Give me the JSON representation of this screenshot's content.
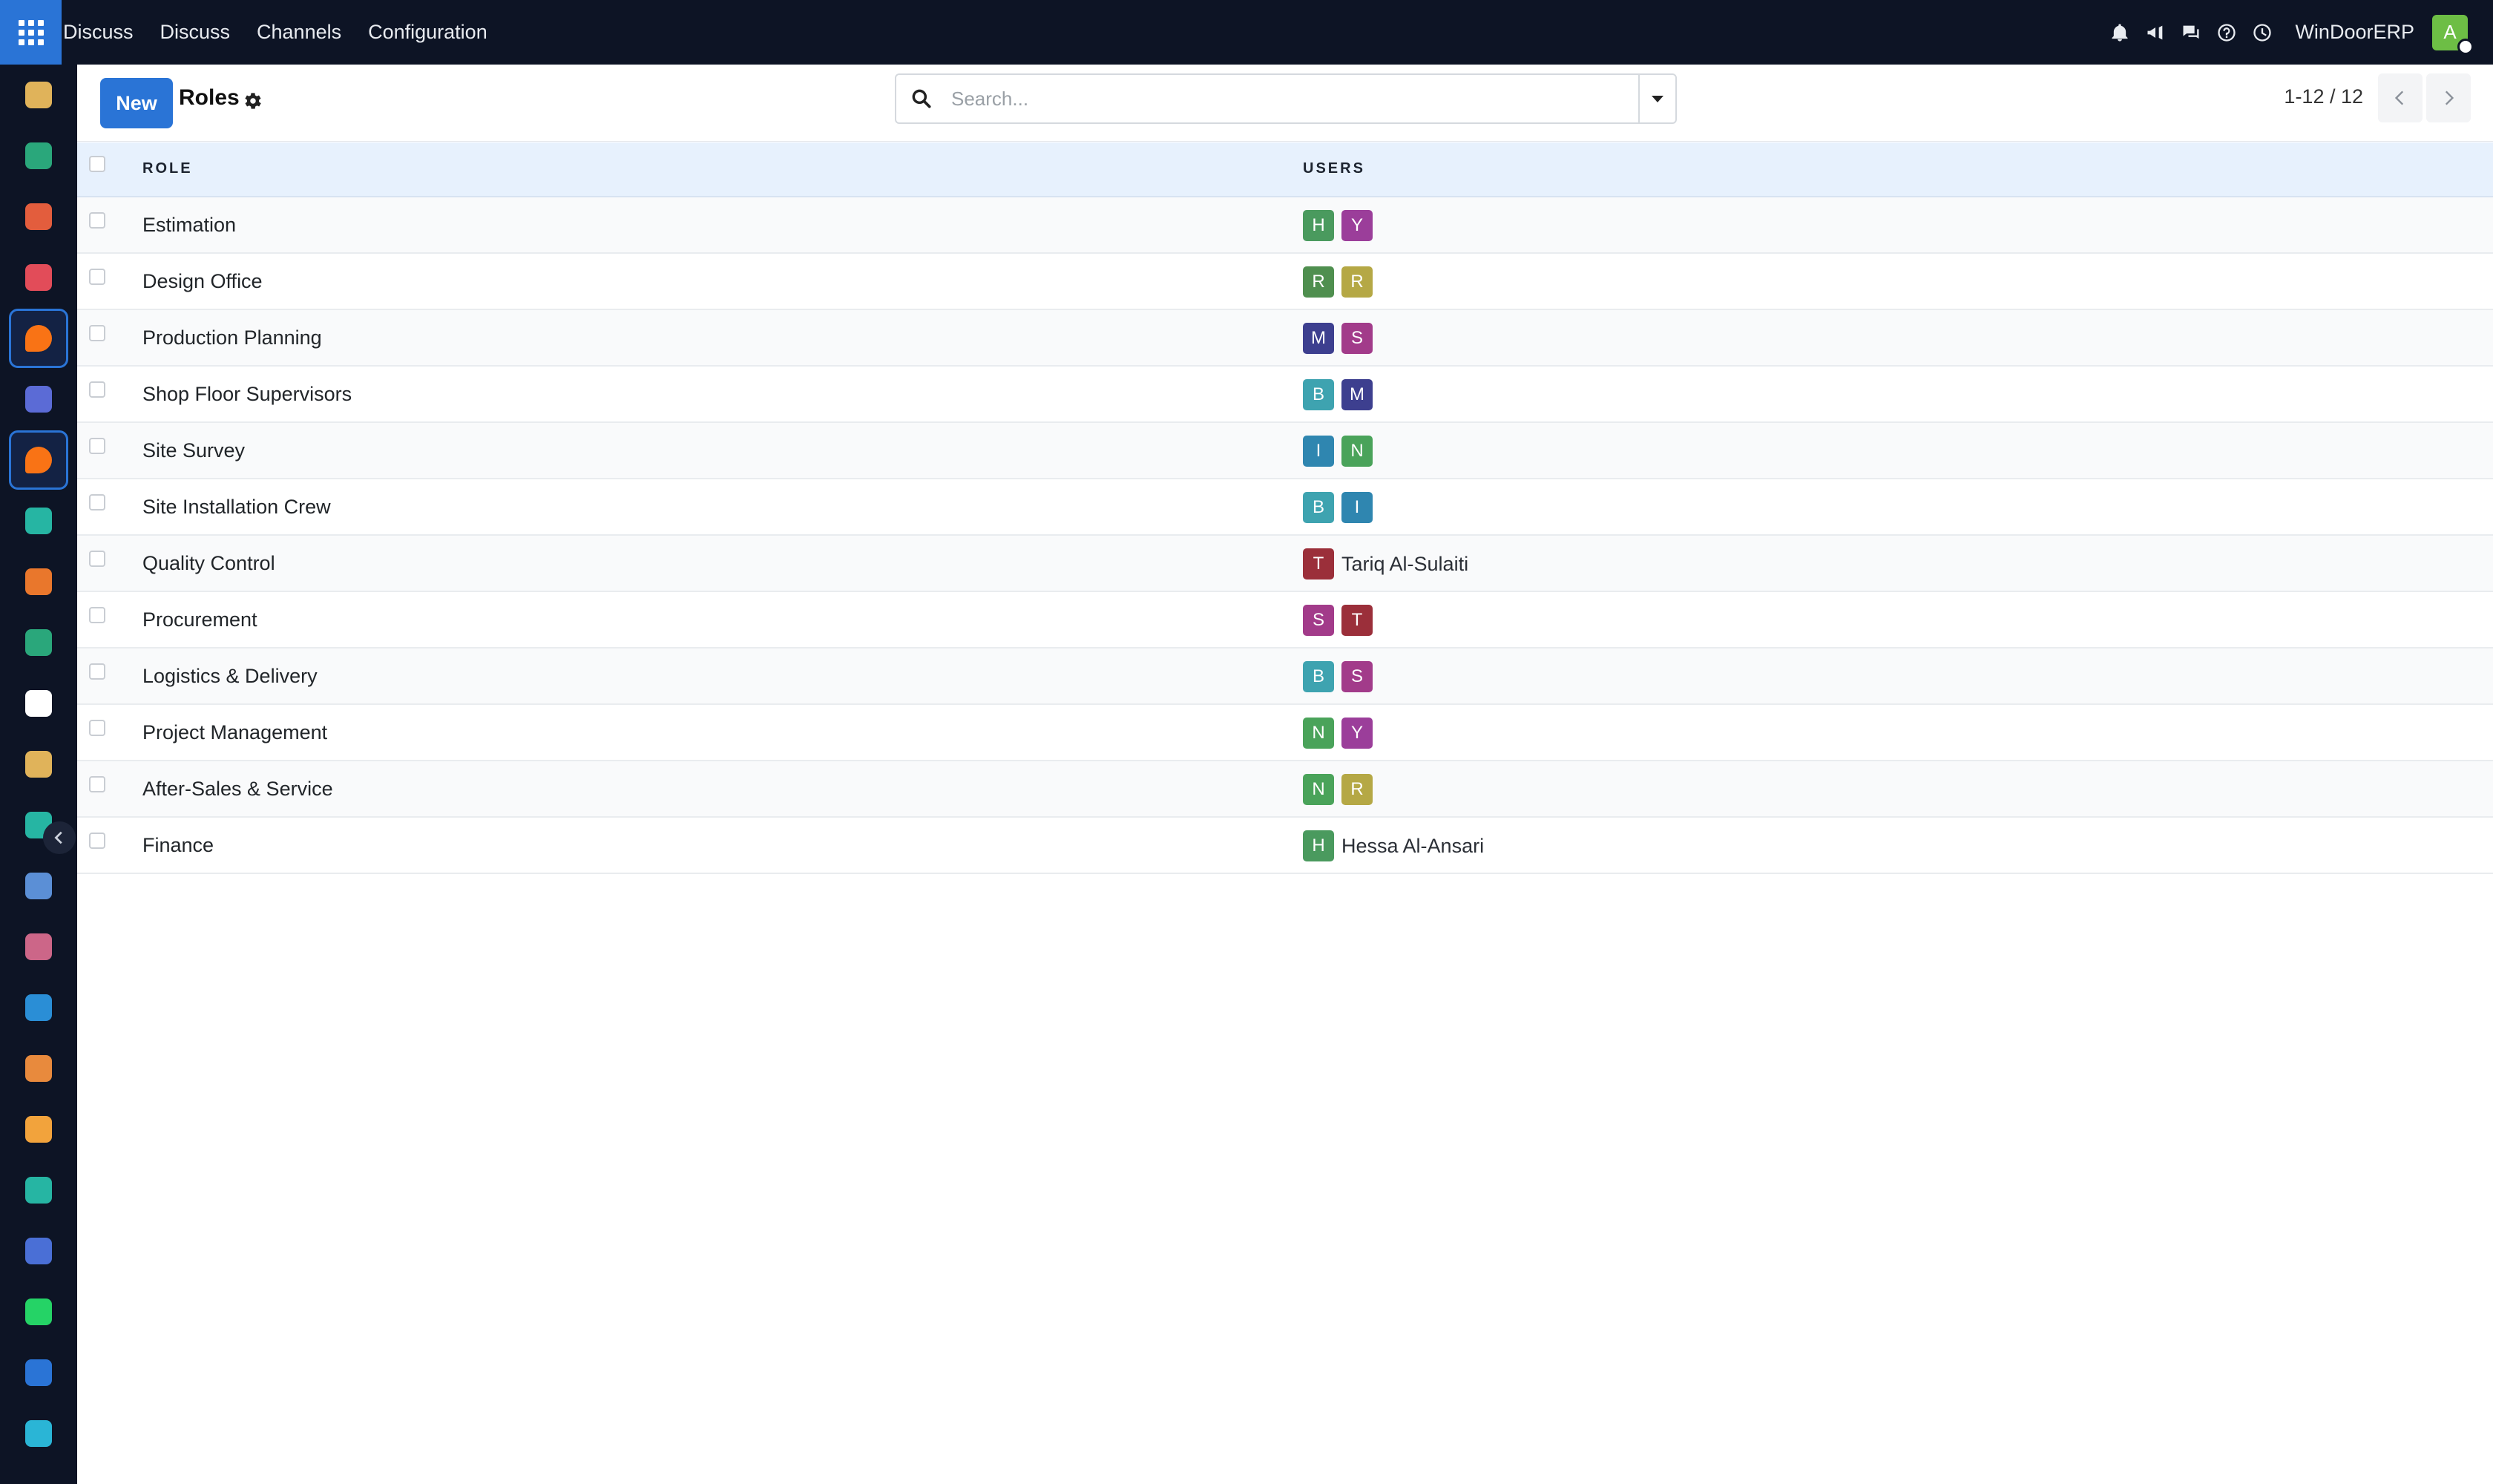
{
  "navbar": {
    "menu": [
      "Discuss",
      "Discuss",
      "Channels",
      "Configuration"
    ],
    "company": "WinDoorERP",
    "user_initial": "A",
    "user_color": "#6dbe45"
  },
  "sidebar": {
    "apps": [
      {
        "name": "app-1",
        "color": "#e0b35a"
      },
      {
        "name": "app-2",
        "color": "#2aa77b"
      },
      {
        "name": "app-3",
        "color": "#e35d3d"
      },
      {
        "name": "app-4",
        "color": "#e24c59"
      },
      {
        "name": "discuss",
        "color": "#f97315",
        "active": true
      },
      {
        "name": "mail",
        "color": "#5b6bd6"
      },
      {
        "name": "discuss-2",
        "color": "#f97315",
        "active": true
      },
      {
        "name": "app-8",
        "color": "#26b5a3"
      },
      {
        "name": "app-9",
        "color": "#e9772c"
      },
      {
        "name": "app-10",
        "color": "#2aa77b"
      },
      {
        "name": "app-11",
        "color": "#ffffff"
      },
      {
        "name": "app-12",
        "color": "#e0b35a"
      },
      {
        "name": "app-13",
        "color": "#26b5a3"
      },
      {
        "name": "app-14",
        "color": "#5b8fd6"
      },
      {
        "name": "app-15",
        "color": "#cc6688"
      },
      {
        "name": "app-16",
        "color": "#2a8ed6"
      },
      {
        "name": "app-17",
        "color": "#e88a3d"
      },
      {
        "name": "calendar",
        "color": "#f2a33c"
      },
      {
        "name": "app-19",
        "color": "#26b5a3"
      },
      {
        "name": "app-20",
        "color": "#4a6fd6"
      },
      {
        "name": "whatsapp",
        "color": "#25d366"
      },
      {
        "name": "app-22",
        "color": "#2a74d6"
      },
      {
        "name": "app-23",
        "color": "#2ab5d6"
      }
    ]
  },
  "control": {
    "new_label": "New",
    "breadcrumb": "Roles",
    "search_placeholder": "Search...",
    "pager": "1-12 / 12"
  },
  "table": {
    "headers": {
      "role": "ROLE",
      "users": "USERS"
    },
    "rows": [
      {
        "role": "Estimation",
        "users": [
          {
            "i": "H",
            "c": "#4a9a5e"
          },
          {
            "i": "Y",
            "c": "#9b3e9a"
          }
        ]
      },
      {
        "role": "Design Office",
        "users": [
          {
            "i": "R",
            "c": "#4f8f4f"
          },
          {
            "i": "R",
            "c": "#b5a845"
          }
        ]
      },
      {
        "role": "Production Planning",
        "users": [
          {
            "i": "M",
            "c": "#3d3f8f"
          },
          {
            "i": "S",
            "c": "#a23b8a"
          }
        ]
      },
      {
        "role": "Shop Floor Supervisors",
        "users": [
          {
            "i": "B",
            "c": "#3ea3b0"
          },
          {
            "i": "M",
            "c": "#3d3f8f"
          }
        ]
      },
      {
        "role": "Site Survey",
        "users": [
          {
            "i": "I",
            "c": "#2f86b0"
          },
          {
            "i": "N",
            "c": "#4aa35a"
          }
        ]
      },
      {
        "role": "Site Installation Crew",
        "users": [
          {
            "i": "B",
            "c": "#3ea3b0"
          },
          {
            "i": "I",
            "c": "#2f86b0"
          }
        ]
      },
      {
        "role": "Quality Control",
        "users": [
          {
            "i": "T",
            "c": "#9b2f3a"
          }
        ],
        "single_name": "Tariq Al-Sulaiti"
      },
      {
        "role": "Procurement",
        "users": [
          {
            "i": "S",
            "c": "#a23b8a"
          },
          {
            "i": "T",
            "c": "#9b2f3a"
          }
        ]
      },
      {
        "role": "Logistics & Delivery",
        "users": [
          {
            "i": "B",
            "c": "#3ea3b0"
          },
          {
            "i": "S",
            "c": "#a23b8a"
          }
        ]
      },
      {
        "role": "Project Management",
        "users": [
          {
            "i": "N",
            "c": "#4aa35a"
          },
          {
            "i": "Y",
            "c": "#9b3e9a"
          }
        ]
      },
      {
        "role": "After-Sales & Service",
        "users": [
          {
            "i": "N",
            "c": "#4aa35a"
          },
          {
            "i": "R",
            "c": "#b5a845"
          }
        ]
      },
      {
        "role": "Finance",
        "users": [
          {
            "i": "H",
            "c": "#4a9a5e"
          }
        ],
        "single_name": "Hessa Al-Ansari"
      }
    ]
  }
}
